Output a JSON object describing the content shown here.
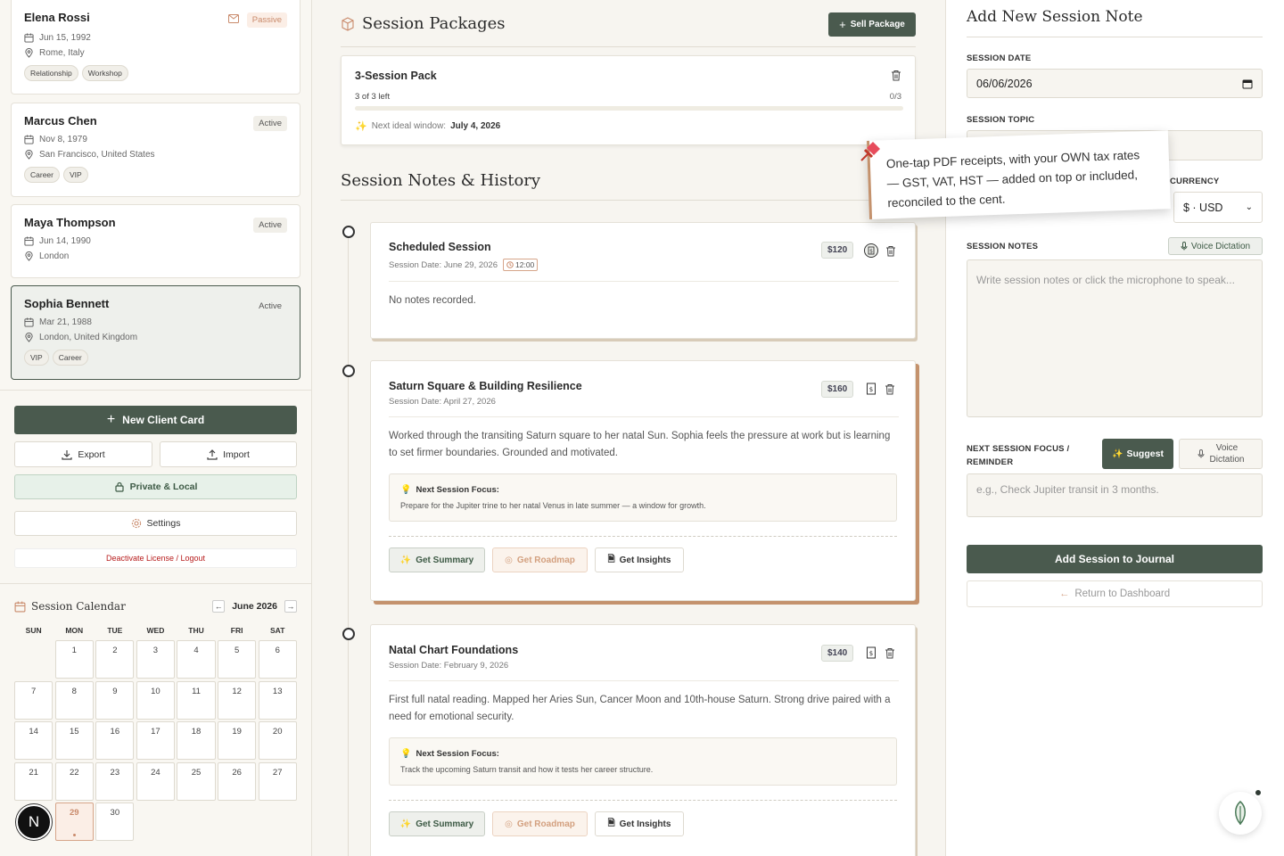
{
  "clients": [
    {
      "name": "Elena Rossi",
      "status": "Passive",
      "birth": "Jun 15, 1992",
      "location": "Rome, Italy",
      "tags": [
        "Relationship",
        "Workshop"
      ]
    },
    {
      "name": "Marcus Chen",
      "status": "Active",
      "birth": "Nov 8, 1979",
      "location": "San Francisco, United States",
      "tags": [
        "Career",
        "VIP"
      ]
    },
    {
      "name": "Maya Thompson",
      "status": "Active",
      "birth": "Jun 14, 1990",
      "location": "London",
      "tags": []
    },
    {
      "name": "Sophia Bennett",
      "status": "Active",
      "birth": "Mar 21, 1988",
      "location": "London, United Kingdom",
      "tags": [
        "VIP",
        "Career"
      ]
    }
  ],
  "sidebar": {
    "new_client": "New Client Card",
    "export": "Export",
    "import": "Import",
    "private": "Private & Local",
    "settings": "Settings",
    "logout": "Deactivate License / Logout"
  },
  "calendar": {
    "title": "Session Calendar",
    "month": "June 2026",
    "prev": "←",
    "next": "→",
    "dow": [
      "SUN",
      "MON",
      "TUE",
      "WED",
      "THU",
      "FRI",
      "SAT"
    ],
    "days": [
      "",
      "1",
      "2",
      "3",
      "4",
      "5",
      "6",
      "7",
      "8",
      "9",
      "10",
      "11",
      "12",
      "13",
      "14",
      "15",
      "16",
      "17",
      "18",
      "19",
      "20",
      "21",
      "22",
      "23",
      "24",
      "25",
      "26",
      "27",
      "",
      "29",
      "30"
    ],
    "today": "29",
    "badge": "N"
  },
  "packages": {
    "title": "Session Packages",
    "sell": "Sell Package",
    "pack_name": "3-Session Pack",
    "left_text": "3 of 3 left",
    "count": "0/3",
    "progress": 0,
    "next_window_label": "Next ideal window:",
    "next_window_date": "July 4, 2026"
  },
  "history": {
    "title": "Session Notes & History",
    "sessions": [
      {
        "title": "Scheduled Session",
        "date": "Session Date: June 29, 2026",
        "time": "12:00",
        "price": "$120",
        "body": "No notes recorded."
      },
      {
        "title": "Saturn Square & Building Resilience",
        "date": "Session Date: April 27, 2026",
        "price": "$160",
        "body": "Worked through the transiting Saturn square to her natal Sun. Sophia feels the pressure at work but is learning to set firmer boundaries. Grounded and motivated.",
        "focus_label": "Next Session Focus:",
        "focus": "Prepare for the Jupiter trine to her natal Venus in late summer — a window for growth."
      },
      {
        "title": "Natal Chart Foundations",
        "date": "Session Date: February 9, 2026",
        "price": "$140",
        "body": "First full natal reading. Mapped her Aries Sun, Cancer Moon and 10th-house Saturn. Strong drive paired with a need for emotional security.",
        "focus_label": "Next Session Focus:",
        "focus": "Track the upcoming Saturn transit and how it tests her career structure."
      }
    ],
    "actions": {
      "summary": "Get Summary",
      "roadmap": "Get Roadmap",
      "insights": "Get Insights"
    }
  },
  "tooltip": {
    "text": "One-tap PDF receipts, with your OWN tax rates — GST, VAT, HST — added on top or included, reconciled to the cent."
  },
  "form": {
    "title": "Add New Session Note",
    "date_label": "SESSION DATE",
    "date_value": "06/06/2026",
    "topic_label": "SESSION TOPIC",
    "currency_label": "CURRENCY",
    "currency_value": "$ · USD",
    "notes_label": "SESSION NOTES",
    "voice": "Voice Dictation",
    "notes_placeholder": "Write session notes or click the microphone to speak...",
    "focus_label_1": "NEXT SESSION FOCUS /",
    "focus_label_2": "REMINDER",
    "suggest": "Suggest",
    "voice_line1": "Voice",
    "voice_line2": "Dictation",
    "focus_placeholder": "e.g., Check Jupiter transit in 3 months.",
    "add": "Add Session to Journal",
    "return": "Return to Dashboard"
  },
  "colors": {
    "brand": "#4a5a4e",
    "accent": "#c4926d",
    "danger": "#b71c1c"
  }
}
